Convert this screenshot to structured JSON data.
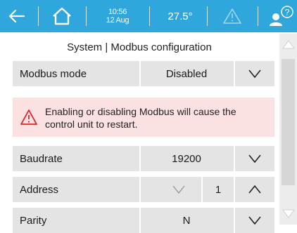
{
  "topbar": {
    "time": "10:56",
    "date": "12 Aug",
    "temperature": "27.5°",
    "bg_color": "#2fa7dc"
  },
  "page": {
    "title": "System | Modbus configuration"
  },
  "rows": [
    {
      "label": "Modbus mode",
      "value": "Disabled"
    },
    {
      "label": "Baudrate",
      "value": "19200"
    },
    {
      "label": "Address",
      "value": "1"
    },
    {
      "label": "Parity",
      "value": "N"
    }
  ],
  "warning": {
    "text": "Enabling or disabling Modbus will cause the control unit to restart.",
    "bg_color": "#fbe1e1",
    "icon_color": "#d9262b"
  },
  "icons": {
    "back": "arrow-left-icon",
    "home": "home-icon",
    "alert": "warning-triangle-icon",
    "help": "user-help-icon",
    "dropdown": "chevron-down-icon",
    "increment": "chevron-up-icon",
    "decrement": "chevron-down-icon",
    "scroll_up": "triangle-up-icon",
    "scroll_down": "triangle-down-icon"
  }
}
